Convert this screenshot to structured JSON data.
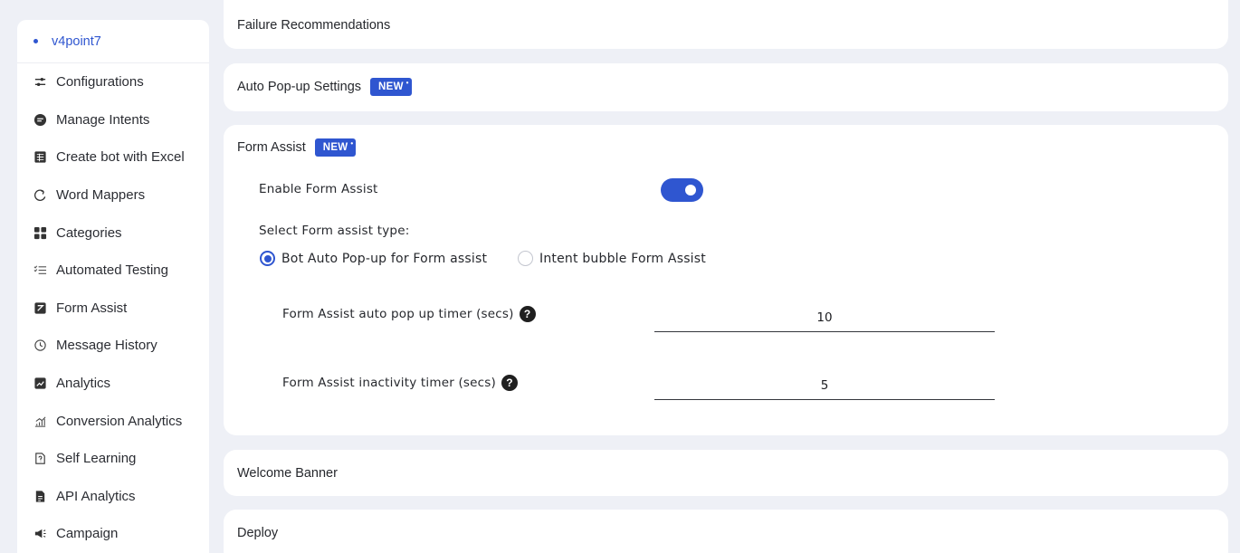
{
  "sidebar": {
    "project": "v4point7",
    "items": [
      {
        "label": "Configurations",
        "icon": "sliders-icon"
      },
      {
        "label": "Manage Intents",
        "icon": "chat-bubble-icon"
      },
      {
        "label": "Create bot with Excel",
        "icon": "spreadsheet-icon"
      },
      {
        "label": "Word Mappers",
        "icon": "word-map-icon"
      },
      {
        "label": "Categories",
        "icon": "grid-icon"
      },
      {
        "label": "Automated Testing",
        "icon": "checklist-icon"
      },
      {
        "label": "Form Assist",
        "icon": "form-icon"
      },
      {
        "label": "Message History",
        "icon": "history-icon"
      },
      {
        "label": "Analytics",
        "icon": "analytics-icon"
      },
      {
        "label": "Conversion Analytics",
        "icon": "bar-chart-icon"
      },
      {
        "label": "Self Learning",
        "icon": "self-learning-icon"
      },
      {
        "label": "API Analytics",
        "icon": "api-doc-icon"
      },
      {
        "label": "Campaign",
        "icon": "megaphone-icon"
      }
    ]
  },
  "sections": {
    "failure": {
      "title": "Failure Recommendations"
    },
    "autopopup": {
      "title": "Auto Pop-up Settings",
      "badge": "NEW"
    },
    "formassist": {
      "title": "Form Assist",
      "badge": "NEW",
      "enable_label": "Enable Form Assist",
      "enable_value": true,
      "type_label": "Select Form assist type:",
      "options": [
        "Bot Auto Pop-up for Form assist",
        "Intent bubble Form Assist"
      ],
      "selected_option": "Bot Auto Pop-up for Form assist",
      "popup_timer_label": "Form Assist auto pop up timer (secs)",
      "popup_timer_value": "10",
      "inactivity_timer_label": "Form Assist inactivity timer (secs)",
      "inactivity_timer_value": "5",
      "help_glyph": "?"
    },
    "welcome": {
      "title": "Welcome Banner"
    },
    "deploy": {
      "title": "Deploy"
    }
  },
  "colors": {
    "accent": "#2f56d0",
    "background": "#eef0f6"
  }
}
